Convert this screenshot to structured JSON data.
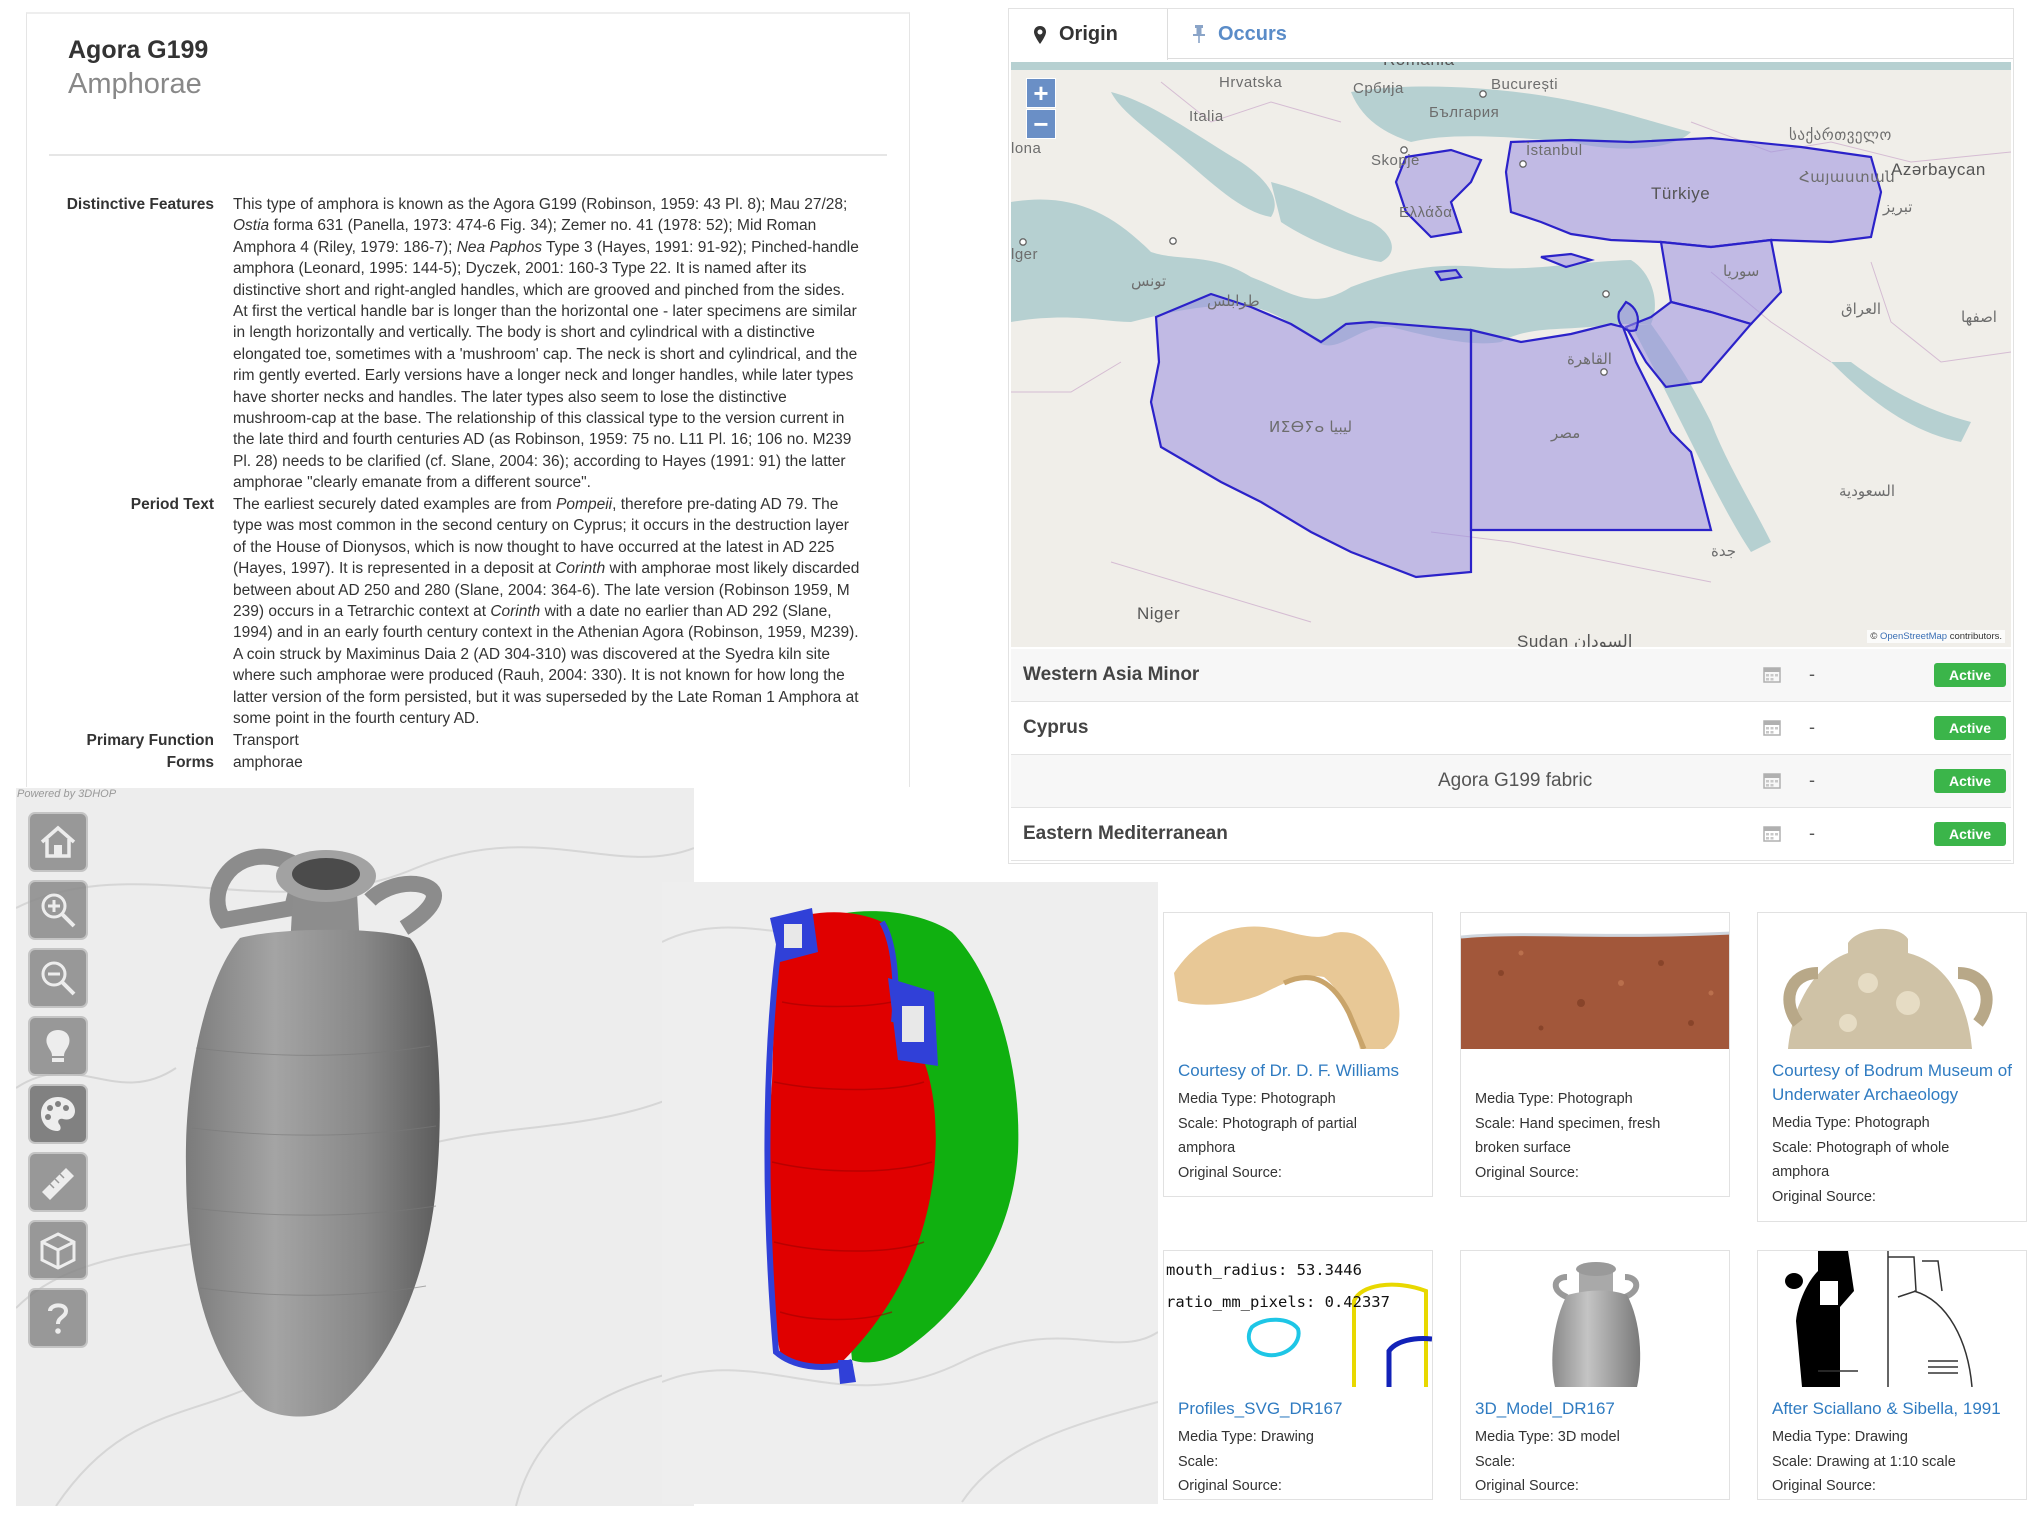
{
  "record": {
    "title": "Agora G199",
    "subtitle": "Amphorae",
    "fields": [
      {
        "label": "Distinctive Features",
        "lines": [
          "This type of amphora is known as the Agora G199 (Robinson, 1959: 43 Pl. 8); Mau 27/28;",
          "<i>Ostia</i> forma 631 (Panella, 1973: 474-6 Fig. 34); Zemer no. 41 (1978: 52); Mid Roman",
          "Amphora 4 (Riley, 1979: 186-7); <i>Nea Paphos</i> Type 3 (Hayes, 1991: 91-92); Pinched-handle",
          "amphora (Leonard, 1995: 144-5); Dyczek, 2001: 160-3 Type 22. It is named after its",
          "distinctive short and right-angled handles, which are grooved and pinched from the sides.",
          "At first the vertical handle bar is longer than the horizontal one - later specimens are similar",
          "in length horizontally and vertically. The body is short and cylindrical with a distinctive",
          "elongated toe, sometimes with a 'mushroom' cap. The neck is short and cylindrical, and the",
          "rim gently everted. Early versions have a longer neck and longer handles, while later types",
          "have shorter necks and handles. The later types also seem to lose the distinctive",
          "mushroom-cap at the base. The relationship of this classical type to the version current in",
          "the late third and fourth centuries AD (as Robinson, 1959: 75 no. L11 Pl. 16; 106 no. M239",
          "Pl. 28) needs to be clarified (cf. Slane, 2004: 36); according to Hayes (1991: 91) the latter",
          "amphorae \"clearly emanate from a different source\"."
        ]
      },
      {
        "label": "Period Text",
        "lines": [
          "The earliest securely dated examples are from <i>Pompeii</i>, therefore pre-dating AD 79. The",
          "type was most common in the second century on Cyprus; it occurs in the destruction layer",
          "of the House of Dionysos, which is now thought to have occurred at the latest in AD 225",
          "(Hayes, 1997). It is represented in a deposit at <i>Corinth</i> with amphorae most likely discarded",
          "between about AD 250 and 280 (Slane, 2004: 364-6). The late version (Robinson 1959, M",
          "239) occurs in a Tetrarchic context at <i>Corinth</i> with a date no earlier than AD 292 (Slane,",
          "1994) and in an early fourth century context in the Athenian Agora (Robinson, 1959, M239).",
          "A coin struck by Maximinus Daia 2 (AD 304-310) was discovered at the Syedra kiln site",
          "where such amphorae were produced (Rauh, 2004: 330). It is not known for how long the",
          "latter version of the form persisted, but it was superseded by the Late Roman 1 Amphora at",
          "some point in the fourth century AD."
        ]
      },
      {
        "label": "Primary Function",
        "lines": [
          "Transport"
        ]
      },
      {
        "label": "Forms",
        "lines": [
          "amphorae"
        ]
      }
    ]
  },
  "map": {
    "tabs": [
      {
        "label": "Origin",
        "icon": "map-marker-icon",
        "active": true
      },
      {
        "label": "Occurs",
        "icon": "pushpin-icon",
        "active": false
      }
    ],
    "zoom_in": "+",
    "zoom_out": "−",
    "labels": [
      {
        "text": "Romania",
        "big": true
      },
      {
        "text": "Hrvatska"
      },
      {
        "text": "Србија"
      },
      {
        "text": "București"
      },
      {
        "text": "Italia"
      },
      {
        "text": "България"
      },
      {
        "text": "Skopje"
      },
      {
        "text": "İstanbul"
      },
      {
        "text": "საქართველო"
      },
      {
        "text": "Հայաստան"
      },
      {
        "text": "Azərbaycan"
      },
      {
        "text": "Türkiye",
        "big": true
      },
      {
        "text": "Ελλάδα"
      },
      {
        "text": "lger"
      },
      {
        "text": "تونس"
      },
      {
        "text": "سوريا"
      },
      {
        "text": "طرابلس"
      },
      {
        "text": "العراق"
      },
      {
        "text": "القاهرة"
      },
      {
        "text": "ⵍⵉⴱⵢⴰ ليبيا"
      },
      {
        "text": "مصر"
      },
      {
        "text": "السعودية"
      },
      {
        "text": "جدة"
      },
      {
        "text": "Niger",
        "big": true
      },
      {
        "text": "Sudan السودان",
        "big": true
      },
      {
        "text": "تبريز"
      },
      {
        "text": "اصفها"
      },
      {
        "text": "lona"
      }
    ],
    "attribution_prefix": "© ",
    "attribution_link": "OpenStreetMap",
    "attribution_suffix": " contributors."
  },
  "origins": [
    {
      "name": "Western Asia Minor",
      "date": "-",
      "status": "Active",
      "centered": false
    },
    {
      "name": "Cyprus",
      "date": "-",
      "status": "Active",
      "centered": false
    },
    {
      "name": "Agora G199 fabric",
      "date": "-",
      "status": "Active",
      "centered": true
    },
    {
      "name": "Eastern Mediterranean",
      "date": "-",
      "status": "Active",
      "centered": false
    }
  ],
  "viewer": {
    "powered_by": "Powered by 3DHOP",
    "tools": [
      "home-icon",
      "zoom-in-icon",
      "zoom-out-icon",
      "light-icon",
      "palette-icon",
      "ruler-icon",
      "section-cube-icon",
      "help-icon"
    ]
  },
  "media": [
    {
      "title": "Courtesy of Dr. D. F. Williams",
      "meta": [
        "Media Type: Photograph",
        "Scale: Photograph of partial",
        "amphora",
        "Original Source:"
      ]
    },
    {
      "title": "",
      "meta": [
        "Media Type: Photograph",
        "Scale: Hand specimen, fresh",
        "broken surface",
        "Original Source:"
      ]
    },
    {
      "title": "Courtesy of Bodrum Museum of Underwater Archaeology",
      "meta": [
        "Media Type: Photograph",
        "Scale: Photograph of whole",
        "amphora",
        "Original Source:"
      ]
    },
    {
      "title": "Profiles_SVG_DR167",
      "meta": [
        "Media Type: Drawing",
        "Scale:",
        "Original Source:"
      ],
      "thumb_text": [
        "mouth_radius: 53.3446",
        "ratio_mm_pixels: 0.42337"
      ]
    },
    {
      "title": "3D_Model_DR167",
      "meta": [
        "Media Type: 3D model",
        "Scale:",
        "Original Source:"
      ]
    },
    {
      "title": "After Sciallano & Sibella, 1991",
      "meta": [
        "Media Type: Drawing",
        "Scale: Drawing at 1:10 scale",
        "Original Source:"
      ]
    }
  ],
  "colors": {
    "link": "#2f7bc1",
    "badge": "#3bb54a",
    "map_sea": "#b6d0d1",
    "map_region": "#9b8fe0",
    "map_region_stroke": "#2b22c9",
    "section_inner": "#e00000",
    "section_outer": "#10b010",
    "section_edge": "#3040d8"
  }
}
